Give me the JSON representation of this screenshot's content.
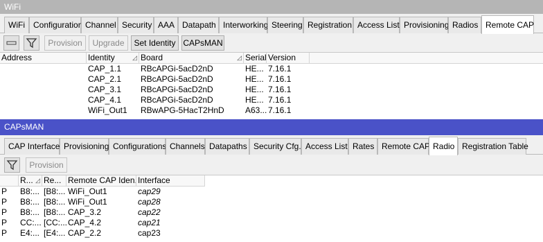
{
  "wifi": {
    "title": "WiFi",
    "tabs": [
      "WiFi",
      "Configuration",
      "Channel",
      "Security",
      "AAA",
      "Datapath",
      "Interworking",
      "Steering",
      "Registration",
      "Access List",
      "Provisioning",
      "Radios",
      "Remote CAP"
    ],
    "active_tab": "Remote CAP",
    "toolbar": {
      "provision": "Provision",
      "upgrade": "Upgrade",
      "set_identity": "Set Identity",
      "capsman": "CAPsMAN"
    },
    "columns": [
      "Address",
      "Identity",
      "Board",
      "Serial",
      "Version"
    ],
    "rows": [
      {
        "address": "",
        "identity": "CAP_1.1",
        "board": "RBcAPGi-5acD2nD",
        "serial": "HE...",
        "version": "7.16.1"
      },
      {
        "address": "",
        "identity": "CAP_2.1",
        "board": "RBcAPGi-5acD2nD",
        "serial": "HE...",
        "version": "7.16.1"
      },
      {
        "address": "",
        "identity": "CAP_3.1",
        "board": "RBcAPGi-5acD2nD",
        "serial": "HE...",
        "version": "7.16.1"
      },
      {
        "address": "",
        "identity": "CAP_4.1",
        "board": "RBcAPGi-5acD2nD",
        "serial": "HE...",
        "version": "7.16.1"
      },
      {
        "address": "",
        "identity": "WiFi_Out1",
        "board": "RBwAPG-5HacT2HnD",
        "serial": "A63...",
        "version": "7.16.1"
      }
    ]
  },
  "capsman": {
    "title": "CAPsMAN",
    "tabs": [
      "CAP Interface",
      "Provisioning",
      "Configurations",
      "Channels",
      "Datapaths",
      "Security Cfg.",
      "Access List",
      "Rates",
      "Remote CAP",
      "Radio",
      "Registration Table"
    ],
    "active_tab": "Radio",
    "toolbar": {
      "provision": "Provision"
    },
    "columns": [
      "R...",
      "Re...",
      "Remote CAP Iden...",
      "Interface"
    ],
    "rows": [
      {
        "flag": "P",
        "r": "B8:...",
        "re": "[B8:...",
        "remote_cap": "WiFi_Out1",
        "interface": "cap29"
      },
      {
        "flag": "P",
        "r": "B8:...",
        "re": "[B8:...",
        "remote_cap": "WiFi_Out1",
        "interface": "cap28"
      },
      {
        "flag": "P",
        "r": "B8:...",
        "re": "[B8:...",
        "remote_cap": "CAP_3.2",
        "interface": "cap22"
      },
      {
        "flag": "P",
        "r": "CC:...",
        "re": "[CC:...",
        "remote_cap": "CAP_4.2",
        "interface": "cap21"
      },
      {
        "flag": "P",
        "r": "E4:...",
        "re": "[E4:...",
        "remote_cap": "CAP_2.2",
        "interface": "cap23"
      }
    ]
  }
}
